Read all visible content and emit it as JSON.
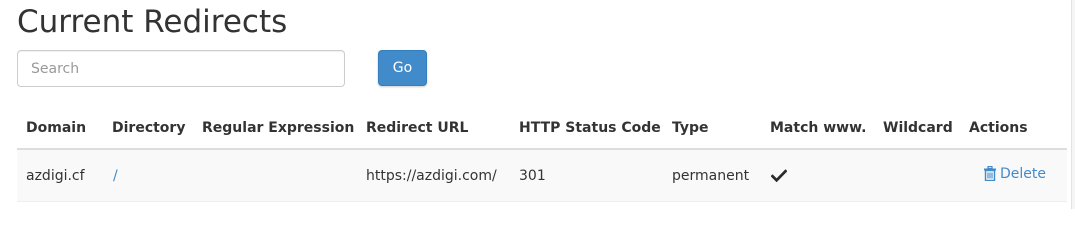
{
  "page": {
    "title": "Current Redirects"
  },
  "search": {
    "placeholder": "Search",
    "value": "",
    "button_label": "Go"
  },
  "table": {
    "headers": {
      "domain": "Domain",
      "directory": "Directory",
      "regex": "Regular Expression",
      "redirect_url": "Redirect URL",
      "status_code": "HTTP Status Code",
      "type": "Type",
      "match_www": "Match www.",
      "wildcard": "Wildcard",
      "actions": "Actions"
    },
    "rows": [
      {
        "domain": "azdigi.cf",
        "directory": "/",
        "regex": "",
        "redirect_url": "https://azdigi.com/",
        "status_code": "301",
        "type": "permanent",
        "match_www_icon": "check-icon",
        "wildcard": "",
        "delete_label": "Delete"
      }
    ]
  },
  "colors": {
    "accent": "#428bca",
    "row_background": "#f9f9f9",
    "header_border": "#dddddd"
  }
}
